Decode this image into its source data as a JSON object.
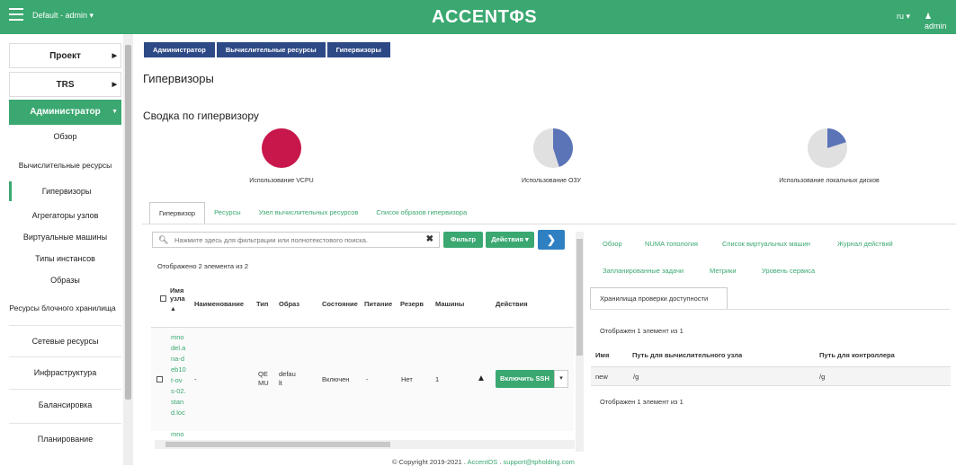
{
  "topbar": {
    "project": "Default - admin ▾",
    "brand": "ACCENTΦS",
    "lang": "ru ▾",
    "user": "admin"
  },
  "sidebar": {
    "items": [
      {
        "label": "Проект"
      },
      {
        "label": "TRS"
      },
      {
        "label": "Администратор"
      }
    ],
    "sub": [
      {
        "label": "Обзор"
      },
      {
        "label": "Вычислительные ресурсы"
      },
      {
        "label": "Гипервизоры"
      },
      {
        "label": "Агрегаторы узлов"
      },
      {
        "label": "Виртуальные машины"
      },
      {
        "label": "Типы инстансов"
      },
      {
        "label": "Образы"
      },
      {
        "label": "Ресурсы блочного хранилища"
      }
    ],
    "groups": [
      {
        "label": "Сетевые ресурсы"
      },
      {
        "label": "Инфраструктура"
      },
      {
        "label": "Балансировка"
      },
      {
        "label": "Планирование"
      }
    ]
  },
  "breadcrumb": [
    "Администратор",
    "Вычислительные ресурсы",
    "Гипервизоры"
  ],
  "page_title": "Гипервизоры",
  "summary": {
    "title": "Сводка по гипервизору",
    "pies": [
      {
        "label": "Использование VCPU",
        "fraction": 1.0
      },
      {
        "label": "Использование ОЗУ",
        "fraction": 0.45
      },
      {
        "label": "Использование локальных дисков",
        "fraction": 0.2
      }
    ],
    "used_color": "#c8174a",
    "used_color_2": "#5b74b8",
    "free_color": "#e0e0e0"
  },
  "tabs": [
    "Гипервизор",
    "Ресурсы",
    "Узел вычислительных ресурсов",
    "Список образов гипервизора"
  ],
  "filter": {
    "placeholder": "Нажмите здесь для фильтрации или полнотекстового поиска.",
    "filter_btn": "Фильтр",
    "actions_btn": "Действия ▾",
    "go_btn": "❯"
  },
  "table": {
    "count": "Отображено 2 элемента из 2",
    "headers": [
      "Имя узла",
      "Наименование",
      "Тип",
      "Образ",
      "Состояние",
      "Питание",
      "Резерв",
      "Машины",
      "Действия"
    ],
    "row": {
      "name_lines": [
        "mno",
        "del.a",
        "na-d",
        "eb10",
        "t-ov",
        "s-02.",
        "stan",
        "d.loc"
      ],
      "title": "-",
      "type_lines": [
        "QE",
        "MU"
      ],
      "image_lines": [
        "defau",
        "lt"
      ],
      "state": "Включен",
      "power": "-",
      "reserve": "Нет",
      "machines": "1",
      "warning": "▲",
      "ssh_btn": "Включить SSH",
      "caret": "▾"
    },
    "next_row_peek": "mno"
  },
  "right": {
    "tabs_row1": [
      "Обзор",
      "NUMA топология",
      "Список виртуальных машин",
      "Журнал действий"
    ],
    "tabs_row2": [
      "Запланированные задачи",
      "Метрики",
      "Уровень сервиса"
    ],
    "active_tab": "Хранилища проверки доступности",
    "count_top": "Отображен 1 элемент из 1",
    "headers": [
      "Имя",
      "Путь для вычислительного узла",
      "Путь для контроллера"
    ],
    "row": [
      "new",
      "/g",
      "/g"
    ],
    "count_bottom": "Отображен 1 элемент из 1"
  },
  "footer": {
    "text": "© Copyright 2019-2021 .",
    "link1": "AccentOS",
    "sep": " . ",
    "link2": "support@tpholding.com"
  }
}
